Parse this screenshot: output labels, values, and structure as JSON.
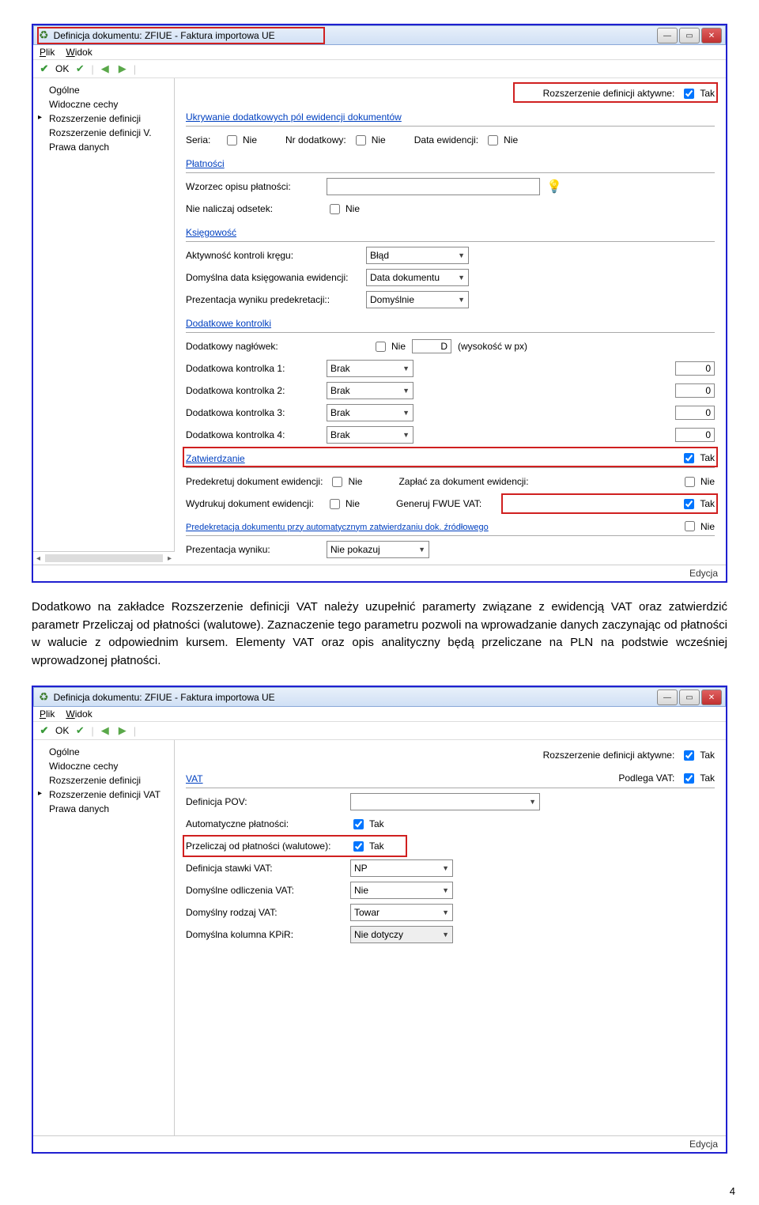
{
  "s1": {
    "title": "Definicja dokumentu: ZFIUE - Faktura importowa UE",
    "menu": {
      "plik": "Plik",
      "widok": "Widok"
    },
    "toolbar": {
      "ok": "OK"
    },
    "nav": {
      "ogolne": "Ogólne",
      "widoczne": "Widoczne cechy",
      "rozsz": "Rozszerzenie definicji",
      "rozszv": "Rozszerzenie definicji V.",
      "prawa": "Prawa danych"
    },
    "top": {
      "rozsz_aktywne": "Rozszerzenie definicji aktywne:",
      "tak": "Tak"
    },
    "hide": {
      "head": "Ukrywanie dodatkowych pól ewidencji dokumentów",
      "seria": "Seria:",
      "nr": "Nr dodatkowy:",
      "data": "Data ewidencji:",
      "nie": "Nie"
    },
    "plat": {
      "head": "Płatności",
      "wzorzec": "Wzorzec opisu płatności:",
      "nie_odsetek": "Nie naliczaj odsetek:",
      "nie": "Nie"
    },
    "ksieg": {
      "head": "Księgowość",
      "aktywn": "Aktywność kontroli kręgu:",
      "aktywn_val": "Błąd",
      "domyslna_data": "Domyślna data księgowania ewidencji:",
      "domyslna_data_val": "Data dokumentu",
      "prezent": "Prezentacja wyniku predekretacji::",
      "prezent_val": "Domyślnie"
    },
    "dod": {
      "head": "Dodatkowe kontrolki",
      "nagl": "Dodatkowy nagłówek:",
      "nie": "Nie",
      "d": "D",
      "px": "(wysokość w px)",
      "k1": "Dodatkowa kontrolka 1:",
      "k2": "Dodatkowa kontrolka 2:",
      "k3": "Dodatkowa kontrolka 3:",
      "k4": "Dodatkowa kontrolka 4:",
      "brak": "Brak",
      "zero": "0"
    },
    "zatw": {
      "head": "Zatwierdzanie",
      "tak": "Tak",
      "predek": "Predekretuj dokument ewidencji:",
      "zaplac": "Zapłać za dokument ewidencji:",
      "wydrukuj": "Wydrukuj dokument ewidencji:",
      "generuj": "Generuj FWUE VAT:",
      "nie": "Nie"
    },
    "auto": {
      "head": "Predekretacja dokumentu przy automatycznym zatwierdzaniu dok. źródłowego",
      "nie": "Nie",
      "prezent": "Prezentacja wyniku:",
      "prezent_val": "Nie pokazuj"
    },
    "status": "Edycja"
  },
  "para": {
    "text": "Dodatkowo na zakładce Rozszerzenie definicji VAT należy uzupełnić paramerty związane z ewidencją VAT oraz zatwierdzić parametr Przeliczaj od płatności (walutowe). Zaznaczenie tego parametru pozwoli na wprowadzanie danych zaczynając od płatności w walucie z odpowiednim kursem. Elementy VAT oraz opis analityczny będą przeliczane na PLN na podstwie wcześniej wprowadzonej płatności."
  },
  "s2": {
    "title": "Definicja dokumentu: ZFIUE - Faktura importowa UE",
    "menu": {
      "plik": "Plik",
      "widok": "Widok"
    },
    "toolbar": {
      "ok": "OK"
    },
    "nav": {
      "ogolne": "Ogólne",
      "widoczne": "Widoczne cechy",
      "rozsz": "Rozszerzenie definicji",
      "rozszvat": "Rozszerzenie definicji VAT",
      "prawa": "Prawa danych"
    },
    "top": {
      "rozsz_aktywne": "Rozszerzenie definicji aktywne:",
      "podlega": "Podlega VAT:",
      "tak": "Tak"
    },
    "vat": {
      "head": "VAT",
      "def_pov": "Definicja POV:",
      "auto_plat": "Automatyczne płatności:",
      "przelicz": "Przeliczaj od płatności (walutowe):",
      "tak": "Tak",
      "def_stawki": "Definicja stawki VAT:",
      "def_stawki_val": "NP",
      "dom_odlicz": "Domyślne odliczenia VAT:",
      "dom_odlicz_val": "Nie",
      "dom_rodzaj": "Domyślny rodzaj VAT:",
      "dom_rodzaj_val": "Towar",
      "dom_kol": "Domyślna kolumna KPiR:",
      "dom_kol_val": "Nie dotyczy"
    },
    "status": "Edycja"
  },
  "page_no": "4"
}
